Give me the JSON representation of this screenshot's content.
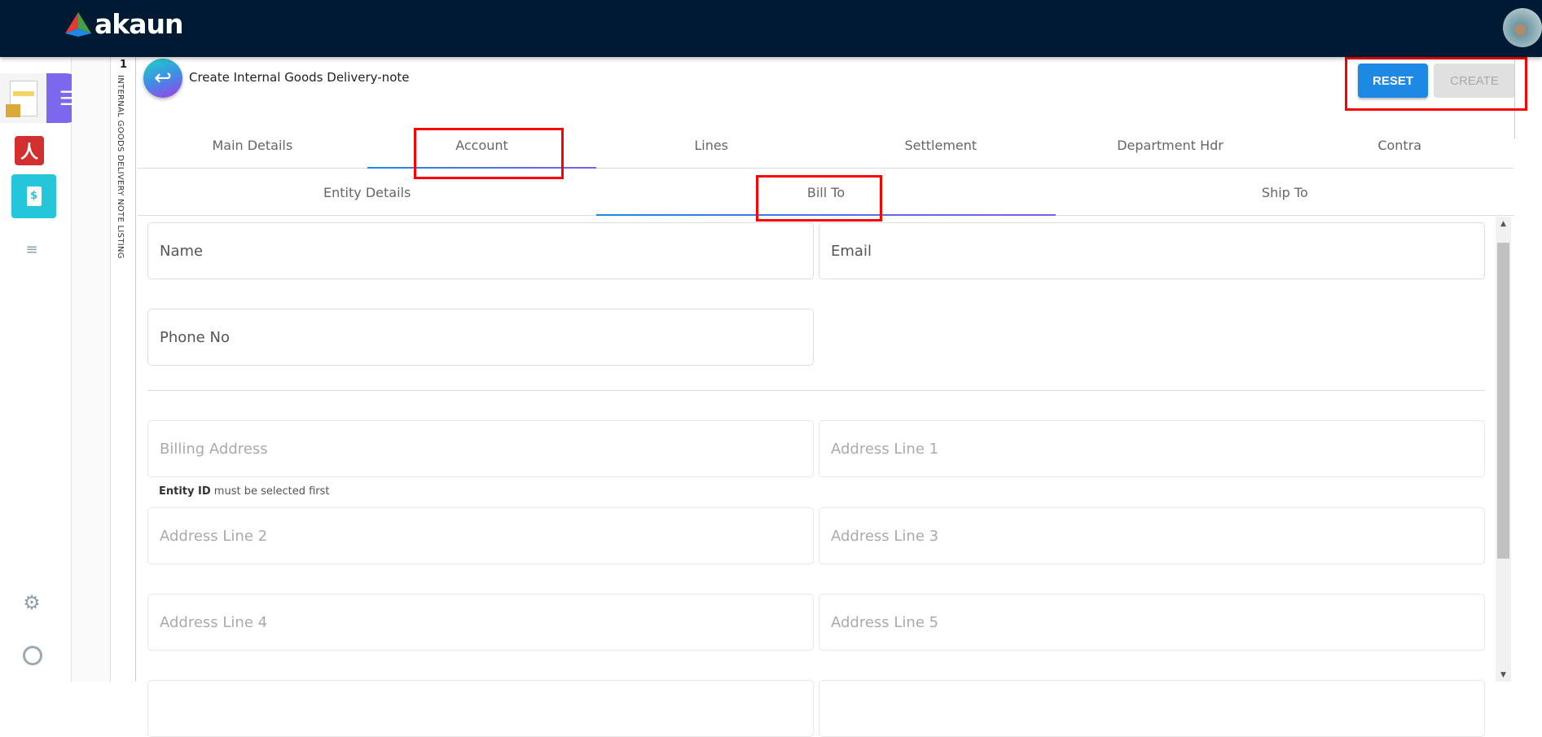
{
  "header": {
    "brand": "akaun"
  },
  "sidebar": {
    "items": [
      {
        "icon": "delivery-note-icon"
      },
      {
        "icon": "menu-toggle-icon"
      },
      {
        "icon": "pdf-icon"
      },
      {
        "icon": "billing-icon"
      },
      {
        "icon": "list-icon"
      },
      {
        "icon": "gear-icon"
      },
      {
        "icon": "user-icon"
      }
    ]
  },
  "listing": {
    "count": "1",
    "label": "INTERNAL GOODS DELIVERY NOTE LISTING"
  },
  "page": {
    "title": "Create Internal Goods Delivery-note",
    "reset": "RESET",
    "create": "CREATE"
  },
  "tabs": [
    "Main Details",
    "Account",
    "Lines",
    "Settlement",
    "Department Hdr",
    "Contra"
  ],
  "subtabs": [
    "Entity Details",
    "Bill To",
    "Ship To"
  ],
  "form": {
    "name": "Name",
    "email": "Email",
    "phone": "Phone No",
    "billing": "Billing Address",
    "line1": "Address Line 1",
    "line2": "Address Line 2",
    "line3": "Address Line 3",
    "line4": "Address Line 4",
    "line5": "Address Line 5",
    "hint_bold": "Entity ID",
    "hint_rest": " must be selected first"
  },
  "colors": {
    "header": "#001a33",
    "accent": "#1e88e5",
    "highlight": "#ff0000"
  }
}
